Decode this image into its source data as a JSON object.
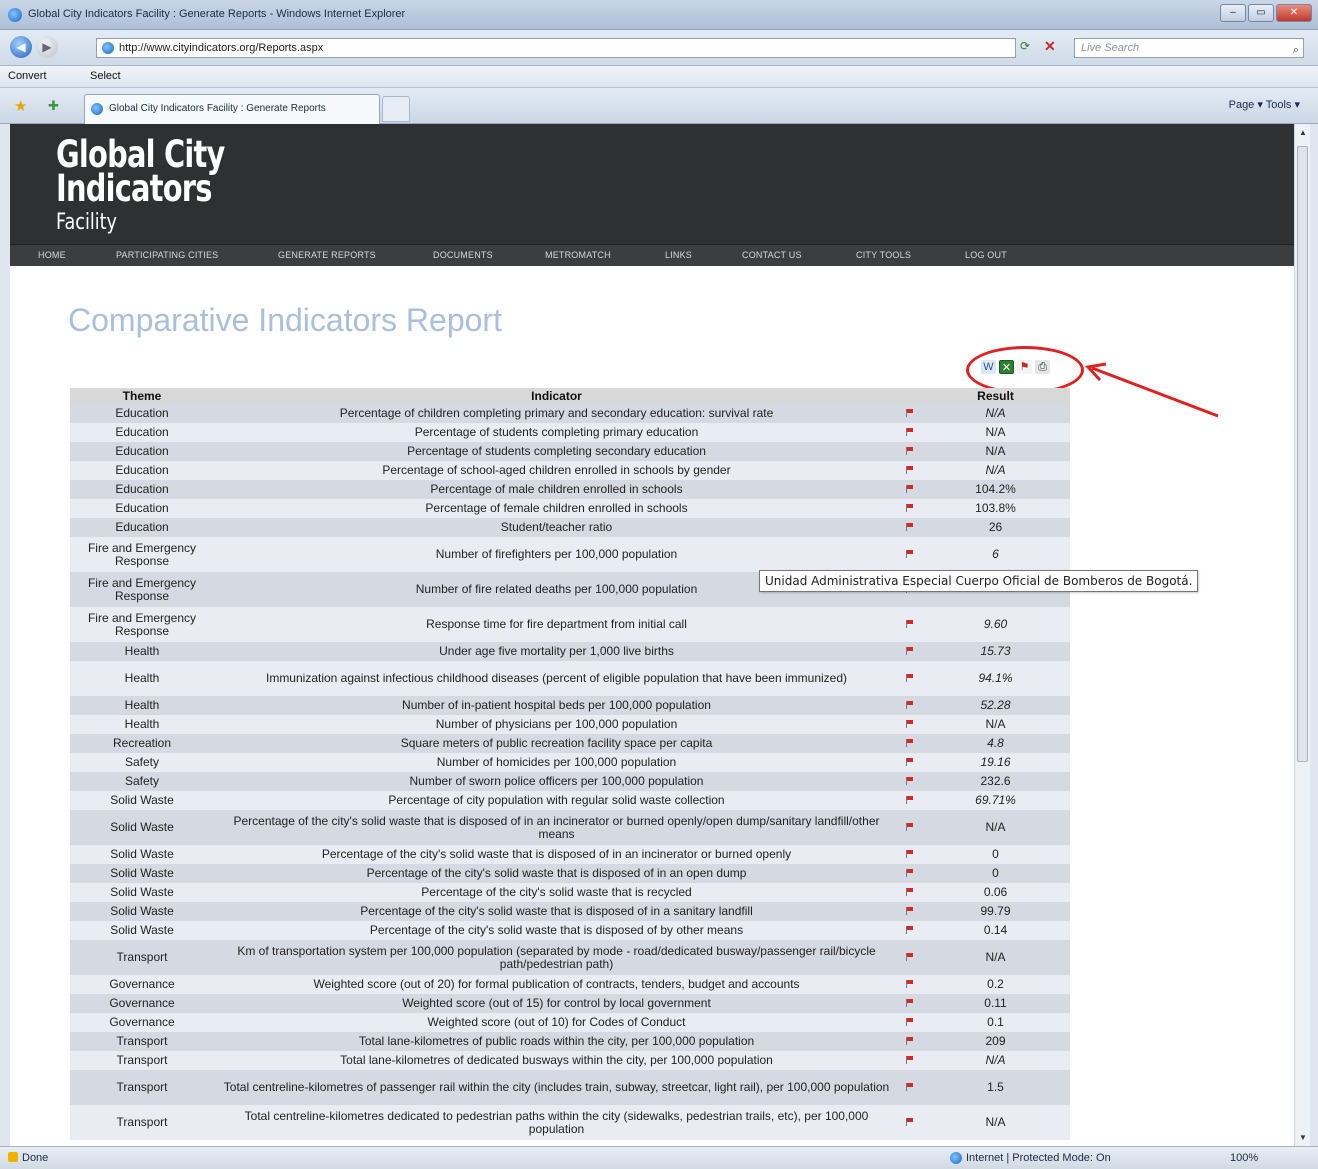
{
  "window": {
    "title": "Global City Indicators Facility : Generate Reports - Windows Internet Explorer",
    "controls": [
      "–",
      "▭",
      "✕"
    ]
  },
  "address_bar": {
    "url": "http://www.cityindicators.org/Reports.aspx",
    "search_placeholder": "Live Search"
  },
  "convert_bar": {
    "convert_label": "Convert",
    "select_label": "Select"
  },
  "tabs": {
    "active_tab": "Global City Indicators Facility : Generate Reports"
  },
  "command_bar": {
    "label": "Page ▾   Tools ▾"
  },
  "site": {
    "logo_line1": "Global City",
    "logo_line2": "Indicators",
    "logo_line3": "Facility",
    "nav": [
      "HOME",
      "PARTICIPATING CITIES",
      "GENERATE REPORTS",
      "DOCUMENTS",
      "METROMATCH",
      "LINKS",
      "CONTACT US",
      "CITY TOOLS",
      "LOG OUT"
    ]
  },
  "report": {
    "title": "Comparative Indicators Report",
    "columns": [
      "Theme",
      "Indicator",
      "",
      "Result"
    ],
    "rows": [
      {
        "theme": "Education",
        "indicator": "Percentage of children completing primary and secondary education: survival rate",
        "result": "N/A"
      },
      {
        "theme": "Education",
        "indicator": "Percentage of students completing primary education",
        "result": "N/A"
      },
      {
        "theme": "Education",
        "indicator": "Percentage of students completing secondary education",
        "result": "N/A"
      },
      {
        "theme": "Education",
        "indicator": "Percentage of school-aged children enrolled in schools by gender",
        "result": "N/A"
      },
      {
        "theme": "Education",
        "indicator": "Percentage of male children enrolled in schools",
        "result": "104.2%"
      },
      {
        "theme": "Education",
        "indicator": "Percentage of female children enrolled in schools",
        "result": "103.8%"
      },
      {
        "theme": "Education",
        "indicator": "Student/teacher ratio",
        "result": "26"
      },
      {
        "theme": "Fire and Emergency Response",
        "indicator": "Number of firefighters per 100,000 population",
        "result": "6"
      },
      {
        "theme": "Fire and Emergency Response",
        "indicator": "Number of fire related deaths per 100,000 population",
        "result": ""
      },
      {
        "theme": "Fire and Emergency Response",
        "indicator": "Response time for fire department from initial call",
        "result": "9.60"
      },
      {
        "theme": "Health",
        "indicator": "Under age five mortality per 1,000 live births",
        "result": "15.73"
      },
      {
        "theme": "Health",
        "indicator": "Immunization against infectious childhood diseases (percent of eligible population that have been immunized)",
        "result": "94.1%"
      },
      {
        "theme": "Health",
        "indicator": "Number of in-patient hospital beds per 100,000 population",
        "result": "52.28"
      },
      {
        "theme": "Health",
        "indicator": "Number of physicians per 100,000 population",
        "result": "N/A"
      },
      {
        "theme": "Recreation",
        "indicator": "Square meters of public recreation facility space per capita",
        "result": "4.8"
      },
      {
        "theme": "Safety",
        "indicator": "Number of homicides per 100,000 population",
        "result": "19.16"
      },
      {
        "theme": "Safety",
        "indicator": "Number of sworn police officers per 100,000 population",
        "result": "232.6"
      },
      {
        "theme": "Solid Waste",
        "indicator": "Percentage of city population with regular solid waste collection",
        "result": "69.71%"
      },
      {
        "theme": "Solid Waste",
        "indicator": "Percentage of the city's solid waste that is disposed of in an incinerator or burned openly/open dump/sanitary landfill/other means",
        "result": "N/A"
      },
      {
        "theme": "Solid Waste",
        "indicator": "Percentage of the city's solid waste that is disposed of in an incinerator or burned openly",
        "result": "0"
      },
      {
        "theme": "Solid Waste",
        "indicator": "Percentage of the city's solid waste that is disposed of in an open dump",
        "result": "0"
      },
      {
        "theme": "Solid Waste",
        "indicator": "Percentage of the city's solid waste that is recycled",
        "result": "0.06"
      },
      {
        "theme": "Solid Waste",
        "indicator": "Percentage of the city's solid waste that is disposed of in a sanitary landfill",
        "result": "99.79"
      },
      {
        "theme": "Solid Waste",
        "indicator": "Percentage of the city's solid waste that is disposed of by other means",
        "result": "0.14"
      },
      {
        "theme": "Transport",
        "indicator": "Km of transportation system per 100,000 population (separated by mode - road/dedicated busway/passenger rail/bicycle path/pedestrian path)",
        "result": "N/A"
      },
      {
        "theme": "Governance",
        "indicator": "Weighted score (out of 20) for formal publication of contracts, tenders, budget and accounts",
        "result": "0.2"
      },
      {
        "theme": "Governance",
        "indicator": "Weighted score (out of 15) for control by local government",
        "result": "0.11"
      },
      {
        "theme": "Governance",
        "indicator": "Weighted score (out of 10) for Codes of Conduct",
        "result": "0.1"
      },
      {
        "theme": "Transport",
        "indicator": "Total lane-kilometres of public roads within the city, per 100,000 population",
        "result": "209"
      },
      {
        "theme": "Transport",
        "indicator": "Total lane-kilometres of dedicated busways within the city, per 100,000 population",
        "result": "N/A"
      },
      {
        "theme": "Transport",
        "indicator": "Total centreline-kilometres of passenger rail within the city (includes train, subway, streetcar, light rail), per 100,000 population",
        "result": "1.5"
      },
      {
        "theme": "Transport",
        "indicator": "Total centreline-kilometres dedicated to pedestrian paths within the city (sidewalks, pedestrian trails, etc), per 100,000 population",
        "result": "N/A"
      }
    ],
    "tooltip": "Unidad Administrativa Especial Cuerpo Oficial de Bomberos de Bogotá."
  },
  "status_bar": {
    "status": "Done",
    "zone": "Internet | Protected Mode: On",
    "zoom": "100%"
  }
}
